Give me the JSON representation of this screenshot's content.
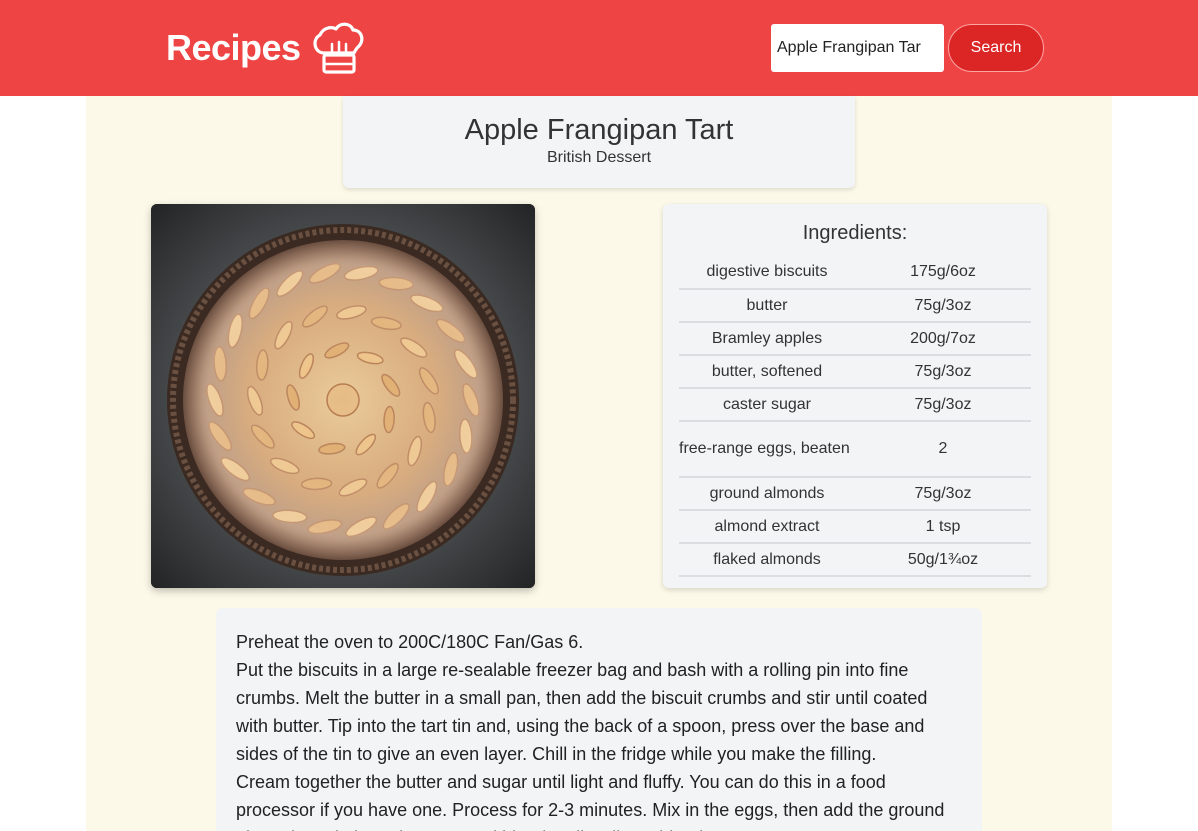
{
  "header": {
    "brand": "Recipes",
    "brand_icon": "chef-hat-icon",
    "search_value": "Apple Frangipan Tar",
    "search_button": "Search",
    "bg_color": "#ef4444",
    "button_color": "#dc2626"
  },
  "recipe": {
    "title": "Apple Frangipan Tart",
    "subtitle": "British Dessert",
    "image_icon": "tart-photo",
    "ingredients_heading": "Ingredients:",
    "ingredients": [
      {
        "name": "digestive biscuits",
        "amount": "175g/6oz"
      },
      {
        "name": "butter",
        "amount": "75g/3oz"
      },
      {
        "name": "Bramley apples",
        "amount": "200g/7oz"
      },
      {
        "name": "butter, softened",
        "amount": "75g/3oz"
      },
      {
        "name": "caster sugar",
        "amount": "75g/3oz"
      },
      {
        "name": "free-range eggs, beaten",
        "amount": "2"
      },
      {
        "name": "ground almonds",
        "amount": "75g/3oz"
      },
      {
        "name": "almond extract",
        "amount": "1 tsp"
      },
      {
        "name": "flaked almonds",
        "amount": "50g/1¾oz"
      }
    ],
    "method": [
      "Preheat the oven to 200C/180C Fan/Gas 6.",
      "Put the biscuits in a large re-sealable freezer bag and bash with a rolling pin into fine crumbs. Melt the butter in a small pan, then add the biscuit crumbs and stir until coated with butter. Tip into the tart tin and, using the back of a spoon, press over the base and sides of the tin to give an even layer. Chill in the fridge while you make the filling.",
      "Cream together the butter and sugar until light and fluffy. You can do this in a food processor if you have one. Process for 2-3 minutes. Mix in the eggs, then add the ground almonds and almond extract and blend until well combined."
    ]
  }
}
